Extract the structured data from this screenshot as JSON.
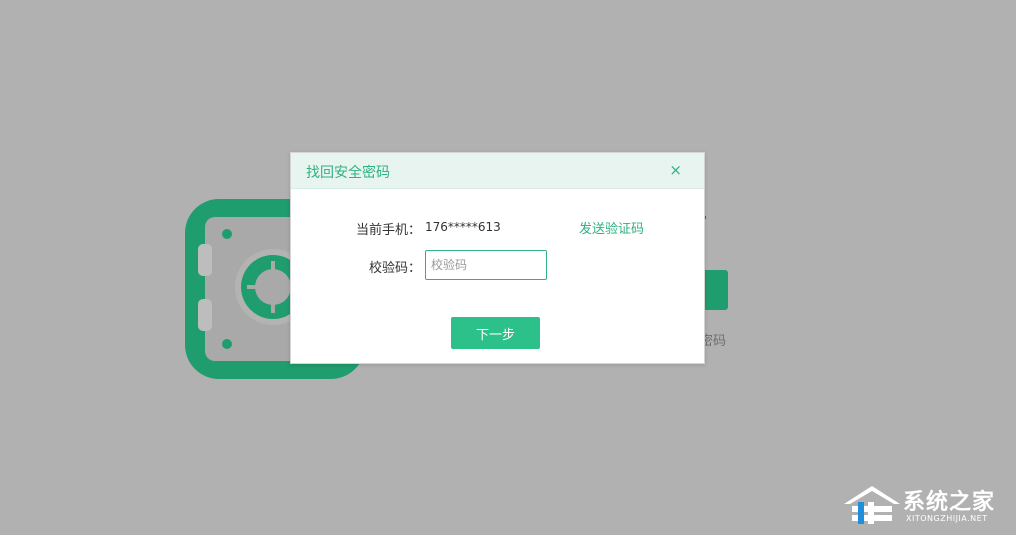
{
  "background": {
    "partial_link": "密码",
    "colors": {
      "overlay": "#b1b1b1",
      "safe_green": "#1f9d6f"
    }
  },
  "dialog": {
    "title": "找回安全密码",
    "close_icon": "×",
    "phone_label": "当前手机：",
    "phone_value": "176*****613",
    "send_code_label": "发送验证码",
    "code_label": "校验码：",
    "code_placeholder": "校验码",
    "code_value": "",
    "next_label": "下一步",
    "colors": {
      "accent": "#2fb180",
      "button": "#2cc08a",
      "header_bg": "#e8f4ef"
    }
  },
  "watermark": {
    "name_cn": "系统之家",
    "name_en": "XITONGZHIJIA.NET"
  }
}
